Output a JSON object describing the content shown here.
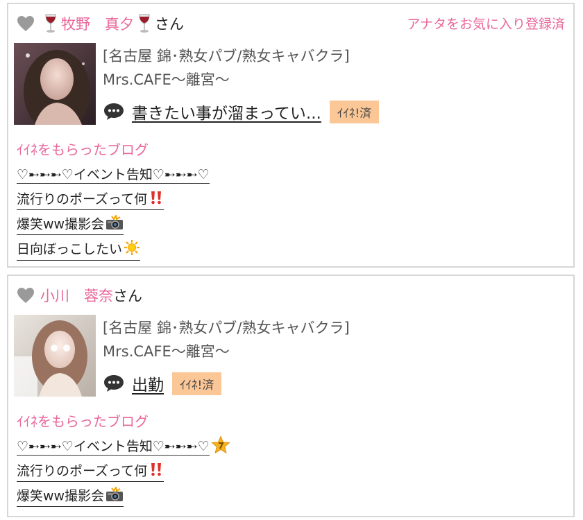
{
  "cards": [
    {
      "name": "牧野　真夕",
      "suffix": "さん",
      "favorite": "アナタをお気に入り登録済",
      "shop_line1": "[名古屋 錦･熟女パブ/熟女キャバクラ]",
      "shop_line2": "Mrs.CAFE～離宮～",
      "post_title": "書きたい事が溜まってい...",
      "badge": "ｲｲﾈ!済",
      "section": "ｲｲﾈをもらったブログ",
      "blogs": [
        "♡➸➸➸♡イベント告知♡➸➸➸♡",
        "流行りのポーズって何",
        "爆笑ww撮影会",
        "日向ぼっこしたい"
      ]
    },
    {
      "name": "小川　蓉奈",
      "suffix": "さん",
      "shop_line1": "[名古屋 錦･熟女パブ/熟女キャバクラ]",
      "shop_line2": "Mrs.CAFE～離宮～",
      "post_title": "出勤",
      "badge": "ｲｲﾈ!済",
      "section": "ｲｲﾈをもらったブログ",
      "blogs": [
        "♡➸➸➸♡イベント告知♡➸➸➸♡",
        "流行りのポーズって何",
        "爆笑ww撮影会"
      ]
    }
  ],
  "icons": {
    "heart": "heart-icon",
    "wine": "wine-glass-icon",
    "comment": "speech-bubble-icon",
    "exclaim": "double-exclamation-icon",
    "camera": "camera-flash-icon",
    "sun": "sun-icon",
    "star": "star-icon"
  },
  "colors": {
    "accent": "#e9679a",
    "badge": "#fcc796",
    "border": "#d6d6d6"
  }
}
